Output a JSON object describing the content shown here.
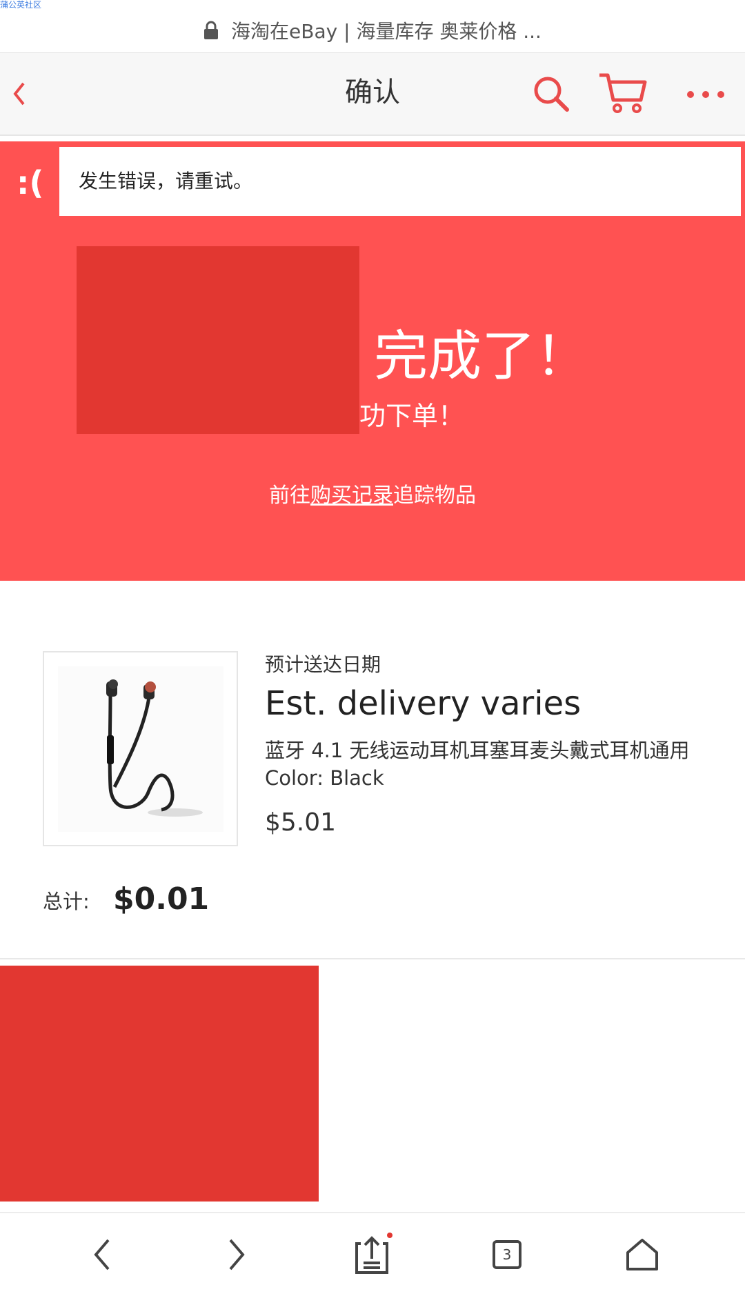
{
  "watermark": "蒲公英社区",
  "url_bar": {
    "text": "海淘在eBay | 海量库存 奥莱价格 ..."
  },
  "header": {
    "title": "确认"
  },
  "error": {
    "face": ":(",
    "message": "发生错误，请重试。"
  },
  "banner": {
    "done_text": "完成了！",
    "ordered_text": "功下单！",
    "track_prefix": "前往",
    "track_link": "购买记录",
    "track_suffix": "追踪物品"
  },
  "order": {
    "eta_label": "预计送达日期",
    "eta_value": "Est. delivery varies",
    "product_name": "蓝牙 4.1 无线运动耳机耳塞耳麦头戴式耳机通用",
    "color": "Color: Black",
    "price": "$5.01",
    "total_label": "总计:",
    "total_value": "$0.01"
  },
  "bottom_nav": {
    "tab_count": "3"
  },
  "colors": {
    "brand_red": "#ff5252",
    "redact": "#e23731",
    "icon_red": "#e94b4b"
  },
  "icons": [
    "lock-icon",
    "back-chevron-icon",
    "search-icon",
    "cart-icon",
    "more-icon",
    "earphones-image",
    "nav-back-icon",
    "nav-forward-icon",
    "share-icon",
    "tabs-icon",
    "home-icon"
  ]
}
